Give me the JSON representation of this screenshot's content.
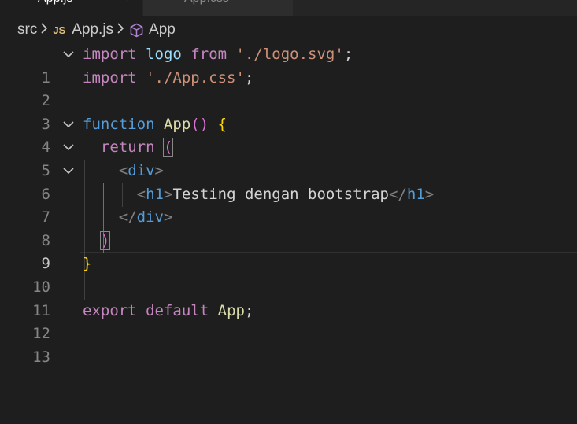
{
  "tabs": [
    {
      "label": "App.js",
      "active": true
    },
    {
      "label": "App.css",
      "active": false
    }
  ],
  "breadcrumb": {
    "folder": "src",
    "file_icon": "JS",
    "file": "App.js",
    "symbol_icon": "cube-icon",
    "symbol": "App"
  },
  "editor": {
    "active_line": 9,
    "line_numbers": [
      "1",
      "2",
      "3",
      "4",
      "5",
      "6",
      "7",
      "8",
      "9",
      "10",
      "11",
      "12",
      "13"
    ],
    "code": {
      "l1": {
        "kw1": "import",
        "id": "logo",
        "kw2": "from",
        "str": "'./logo.svg'",
        "semi": ";"
      },
      "l2": {
        "kw": "import",
        "str": "'./App.css'",
        "semi": ";"
      },
      "l4": {
        "kw": "function",
        "fn": "App",
        "parens": "()",
        "brace": "{"
      },
      "l5": {
        "kw": "return",
        "paren": "("
      },
      "l6": {
        "open": "<",
        "tag": "div",
        "close": ">"
      },
      "l7": {
        "open": "<",
        "tag": "h1",
        "close": ">",
        "text": "Testing dengan bootstrap",
        "open2": "</",
        "tag2": "h1",
        "close2": ">"
      },
      "l8": {
        "open": "</",
        "tag": "div",
        "close": ">"
      },
      "l9": {
        "paren": ")"
      },
      "l10": {
        "brace": "}"
      },
      "l12": {
        "kw1": "export",
        "kw2": "default",
        "id": "App",
        "semi": ";"
      }
    }
  },
  "colors": {
    "background": "#1e1e1e",
    "keyword_control": "#c586c0",
    "keyword_storage": "#569cd6",
    "function": "#dcdcaa",
    "string": "#ce9178",
    "variable": "#9cdcfe",
    "bracket_level1": "#ffd700",
    "bracket_level2": "#da70d6"
  }
}
